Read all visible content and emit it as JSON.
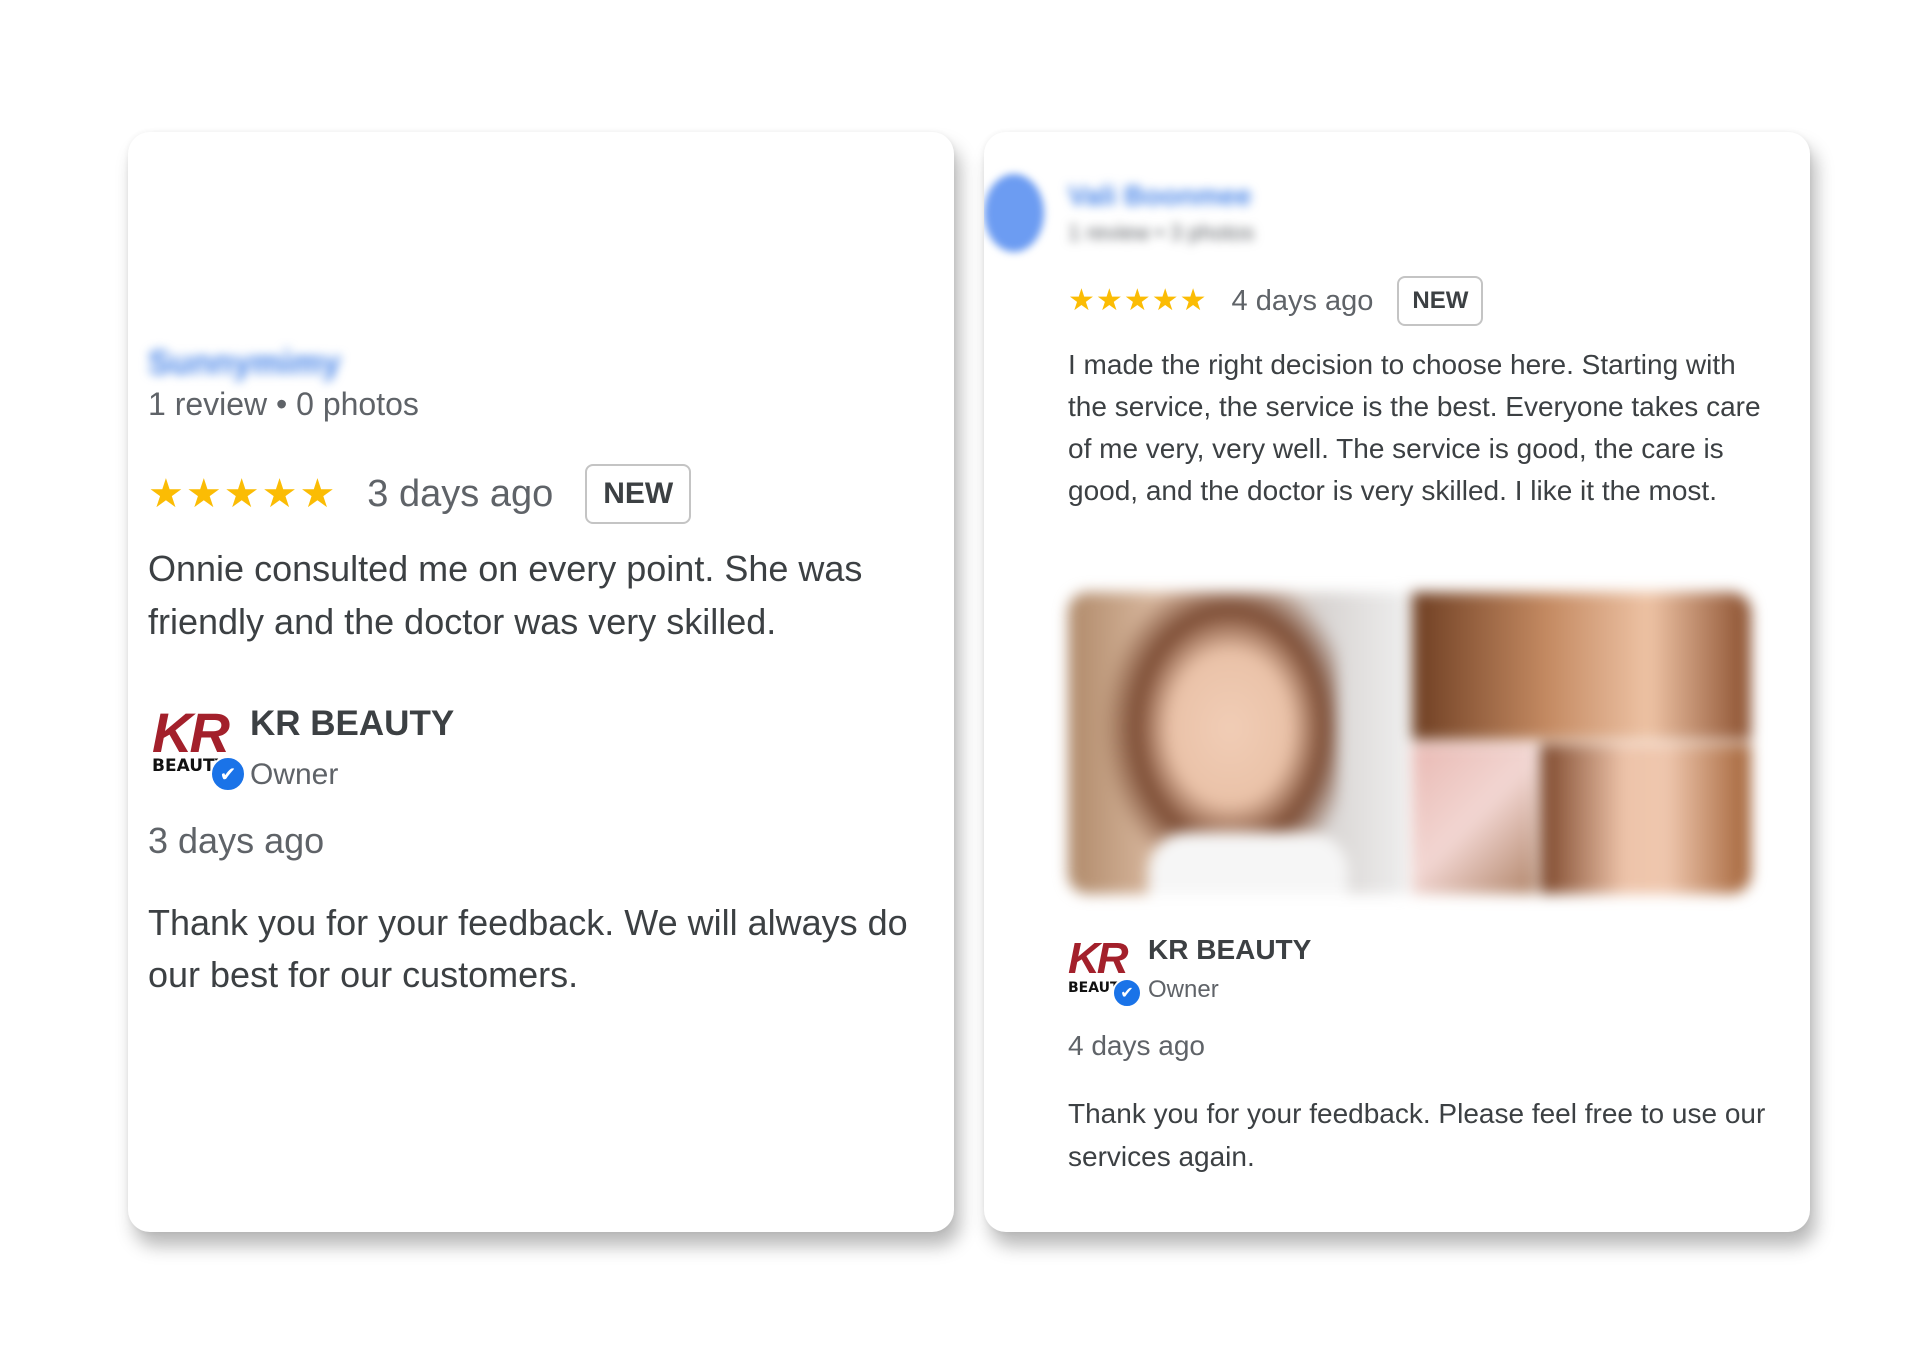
{
  "reviews": [
    {
      "reviewer_name": "Sunnymimy",
      "reviewer_meta": "1 review • 0 photos",
      "rating": 5,
      "stars": [
        "★",
        "★",
        "★",
        "★",
        "★"
      ],
      "date": "3 days ago",
      "badge": "NEW",
      "text": "Onnie consulted me on every point. She was friendly and the doctor was very skilled.",
      "owner_reply": {
        "logo_text": "KR",
        "logo_subtext": "BEAUTY",
        "verified_icon": "✔",
        "owner_name": "KR BEAUTY",
        "owner_role": "Owner",
        "date": "3 days ago",
        "text": "Thank you for your feedback. We will always do our best for our customers."
      }
    },
    {
      "reviewer_name": "Vali Boonmee",
      "reviewer_meta": "1 review • 3 photos",
      "rating": 5,
      "stars": [
        "★",
        "★",
        "★",
        "★",
        "★"
      ],
      "date": "4 days ago",
      "badge": "NEW",
      "text": "I made the right decision to choose here. Starting with the service, the service is the best. Everyone takes care of me very, very well. The service is good, the care is good, and the doctor is very skilled. I like it the most.",
      "photos_count": 4,
      "owner_reply": {
        "logo_text": "KR",
        "logo_subtext": "BEAUTY",
        "verified_icon": "✔",
        "owner_name": "KR BEAUTY",
        "owner_role": "Owner",
        "date": "4 days ago",
        "text": "Thank you for your feedback. Please feel free to use our services again."
      }
    }
  ],
  "colors": {
    "star": "#fbbc04",
    "verified": "#1a73e8",
    "logo_red": "#a3202b",
    "reviewer_name_blurred": "#4a86e8"
  }
}
